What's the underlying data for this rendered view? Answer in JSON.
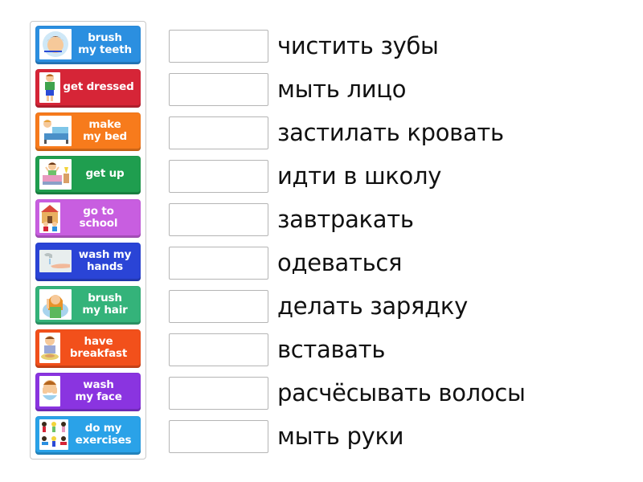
{
  "tiles": [
    {
      "label": "brush\nmy teeth",
      "color": "#2b8fe0",
      "icon": "boy-brushing-teeth-icon"
    },
    {
      "label": "get dressed",
      "color": "#d62537",
      "icon": "child-dressing-icon"
    },
    {
      "label": "make\nmy bed",
      "color": "#f77b1c",
      "icon": "child-making-bed-icon"
    },
    {
      "label": "get up",
      "color": "#1f9e4f",
      "icon": "child-waking-up-icon"
    },
    {
      "label": "go to\nschool",
      "color": "#c85ee0",
      "icon": "children-school-icon"
    },
    {
      "label": "wash my\nhands",
      "color": "#2a44d6",
      "icon": "washing-hands-icon"
    },
    {
      "label": "brush\nmy hair",
      "color": "#34b37a",
      "icon": "girl-brushing-hair-icon"
    },
    {
      "label": "have\nbreakfast",
      "color": "#f2501b",
      "icon": "child-eating-breakfast-icon"
    },
    {
      "label": "wash\nmy face",
      "color": "#8a34e0",
      "icon": "child-washing-face-icon"
    },
    {
      "label": "do my\nexercises",
      "color": "#2aa2e8",
      "icon": "children-exercising-icon"
    }
  ],
  "targets": [
    {
      "phrase": "чистить зубы",
      "answer": ""
    },
    {
      "phrase": "мыть лицо",
      "answer": ""
    },
    {
      "phrase": "застилать кровать",
      "answer": ""
    },
    {
      "phrase": "идти в школу",
      "answer": ""
    },
    {
      "phrase": "завтракать",
      "answer": ""
    },
    {
      "phrase": "одеваться",
      "answer": ""
    },
    {
      "phrase": "делать зарядку",
      "answer": ""
    },
    {
      "phrase": "вставать",
      "answer": ""
    },
    {
      "phrase": "расчёсывать волосы",
      "answer": ""
    },
    {
      "phrase": "мыть руки",
      "answer": ""
    }
  ]
}
